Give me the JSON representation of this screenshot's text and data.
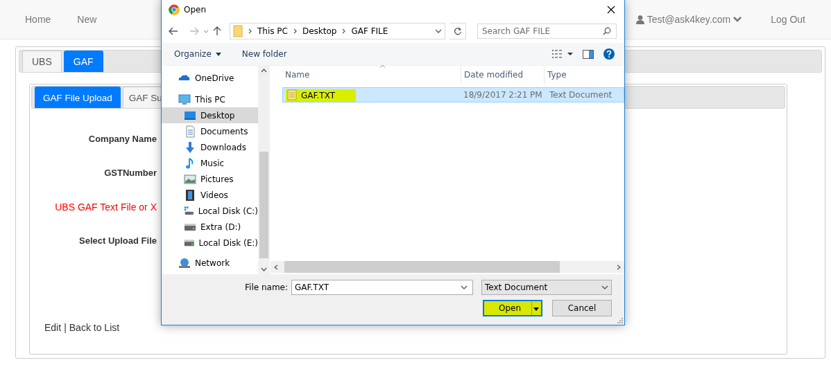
{
  "navbar": {
    "links": [
      "Home",
      "New"
    ],
    "user": "Test@ask4key.com",
    "logout": "Log Out"
  },
  "outer_tabs": [
    {
      "label": "UBS",
      "selected": false
    },
    {
      "label": "GAF",
      "selected": true
    }
  ],
  "inner_tabs": [
    {
      "label": "GAF File Upload",
      "selected": true
    },
    {
      "label": "GAF Su",
      "selected": false
    }
  ],
  "form": {
    "labels": [
      {
        "text": "Company Name",
        "kind": "plain"
      },
      {
        "text": "GSTNumber",
        "kind": "plain"
      },
      {
        "text": "UBS GAF Text File or X",
        "kind": "alert"
      },
      {
        "text": "Select Upload File",
        "kind": "plain"
      }
    ],
    "links": [
      "Edit",
      "Back to List"
    ],
    "separator": "|"
  },
  "dialog": {
    "title": "Open",
    "path": [
      "This PC",
      "Desktop",
      "GAF FILE"
    ],
    "search": {
      "placeholder": "Search GAF FILE"
    },
    "toolbar": {
      "organize": "Organize",
      "new_folder": "New folder"
    },
    "nav_items": [
      {
        "label": "OneDrive",
        "kind": "cloud",
        "selected": false
      },
      {
        "label": "This PC",
        "kind": "pc",
        "selected": false,
        "children": [
          {
            "label": "Desktop",
            "kind": "desktop",
            "selected": true
          },
          {
            "label": "Documents",
            "kind": "documents",
            "selected": false
          },
          {
            "label": "Downloads",
            "kind": "downloads",
            "selected": false
          },
          {
            "label": "Music",
            "kind": "music",
            "selected": false
          },
          {
            "label": "Pictures",
            "kind": "pictures",
            "selected": false
          },
          {
            "label": "Videos",
            "kind": "videos",
            "selected": false
          },
          {
            "label": "Local Disk (C:)",
            "kind": "windisk",
            "selected": false
          },
          {
            "label": "Extra (D:)",
            "kind": "disk",
            "selected": false
          },
          {
            "label": "Local Disk (E:)",
            "kind": "disk",
            "selected": false
          }
        ]
      },
      {
        "label": "Network",
        "kind": "network",
        "selected": false
      }
    ],
    "columns": [
      "Name",
      "Date modified",
      "Type"
    ],
    "files": [
      {
        "name": "GAF.TXT",
        "date": "18/9/2017 2:21 PM",
        "type": "Text Document",
        "selected": true,
        "highlighted": true
      }
    ],
    "file_name_label": "File name:",
    "file_name": "GAF.TXT",
    "file_type": "Text Document",
    "buttons": [
      {
        "label": "Open",
        "kind": "split",
        "highlighted": true
      },
      {
        "label": "Cancel",
        "kind": "plain",
        "highlighted": false
      }
    ]
  }
}
